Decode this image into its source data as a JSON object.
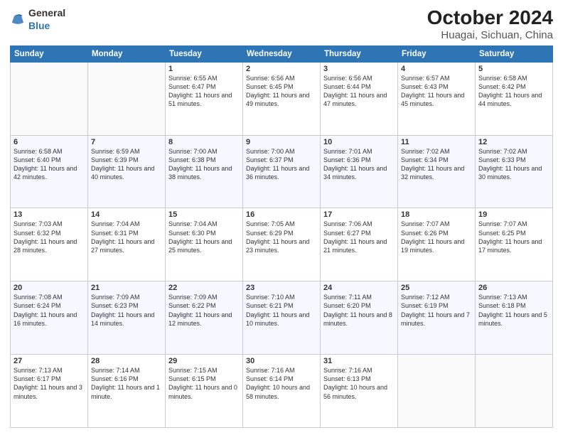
{
  "header": {
    "logo_general": "General",
    "logo_blue": "Blue",
    "title": "October 2024",
    "subtitle": "Huagai, Sichuan, China"
  },
  "weekdays": [
    "Sunday",
    "Monday",
    "Tuesday",
    "Wednesday",
    "Thursday",
    "Friday",
    "Saturday"
  ],
  "weeks": [
    [
      {
        "day": "",
        "sunrise": "",
        "sunset": "",
        "daylight": ""
      },
      {
        "day": "",
        "sunrise": "",
        "sunset": "",
        "daylight": ""
      },
      {
        "day": "1",
        "sunrise": "Sunrise: 6:55 AM",
        "sunset": "Sunset: 6:47 PM",
        "daylight": "Daylight: 11 hours and 51 minutes."
      },
      {
        "day": "2",
        "sunrise": "Sunrise: 6:56 AM",
        "sunset": "Sunset: 6:45 PM",
        "daylight": "Daylight: 11 hours and 49 minutes."
      },
      {
        "day": "3",
        "sunrise": "Sunrise: 6:56 AM",
        "sunset": "Sunset: 6:44 PM",
        "daylight": "Daylight: 11 hours and 47 minutes."
      },
      {
        "day": "4",
        "sunrise": "Sunrise: 6:57 AM",
        "sunset": "Sunset: 6:43 PM",
        "daylight": "Daylight: 11 hours and 45 minutes."
      },
      {
        "day": "5",
        "sunrise": "Sunrise: 6:58 AM",
        "sunset": "Sunset: 6:42 PM",
        "daylight": "Daylight: 11 hours and 44 minutes."
      }
    ],
    [
      {
        "day": "6",
        "sunrise": "Sunrise: 6:58 AM",
        "sunset": "Sunset: 6:40 PM",
        "daylight": "Daylight: 11 hours and 42 minutes."
      },
      {
        "day": "7",
        "sunrise": "Sunrise: 6:59 AM",
        "sunset": "Sunset: 6:39 PM",
        "daylight": "Daylight: 11 hours and 40 minutes."
      },
      {
        "day": "8",
        "sunrise": "Sunrise: 7:00 AM",
        "sunset": "Sunset: 6:38 PM",
        "daylight": "Daylight: 11 hours and 38 minutes."
      },
      {
        "day": "9",
        "sunrise": "Sunrise: 7:00 AM",
        "sunset": "Sunset: 6:37 PM",
        "daylight": "Daylight: 11 hours and 36 minutes."
      },
      {
        "day": "10",
        "sunrise": "Sunrise: 7:01 AM",
        "sunset": "Sunset: 6:36 PM",
        "daylight": "Daylight: 11 hours and 34 minutes."
      },
      {
        "day": "11",
        "sunrise": "Sunrise: 7:02 AM",
        "sunset": "Sunset: 6:34 PM",
        "daylight": "Daylight: 11 hours and 32 minutes."
      },
      {
        "day": "12",
        "sunrise": "Sunrise: 7:02 AM",
        "sunset": "Sunset: 6:33 PM",
        "daylight": "Daylight: 11 hours and 30 minutes."
      }
    ],
    [
      {
        "day": "13",
        "sunrise": "Sunrise: 7:03 AM",
        "sunset": "Sunset: 6:32 PM",
        "daylight": "Daylight: 11 hours and 28 minutes."
      },
      {
        "day": "14",
        "sunrise": "Sunrise: 7:04 AM",
        "sunset": "Sunset: 6:31 PM",
        "daylight": "Daylight: 11 hours and 27 minutes."
      },
      {
        "day": "15",
        "sunrise": "Sunrise: 7:04 AM",
        "sunset": "Sunset: 6:30 PM",
        "daylight": "Daylight: 11 hours and 25 minutes."
      },
      {
        "day": "16",
        "sunrise": "Sunrise: 7:05 AM",
        "sunset": "Sunset: 6:29 PM",
        "daylight": "Daylight: 11 hours and 23 minutes."
      },
      {
        "day": "17",
        "sunrise": "Sunrise: 7:06 AM",
        "sunset": "Sunset: 6:27 PM",
        "daylight": "Daylight: 11 hours and 21 minutes."
      },
      {
        "day": "18",
        "sunrise": "Sunrise: 7:07 AM",
        "sunset": "Sunset: 6:26 PM",
        "daylight": "Daylight: 11 hours and 19 minutes."
      },
      {
        "day": "19",
        "sunrise": "Sunrise: 7:07 AM",
        "sunset": "Sunset: 6:25 PM",
        "daylight": "Daylight: 11 hours and 17 minutes."
      }
    ],
    [
      {
        "day": "20",
        "sunrise": "Sunrise: 7:08 AM",
        "sunset": "Sunset: 6:24 PM",
        "daylight": "Daylight: 11 hours and 16 minutes."
      },
      {
        "day": "21",
        "sunrise": "Sunrise: 7:09 AM",
        "sunset": "Sunset: 6:23 PM",
        "daylight": "Daylight: 11 hours and 14 minutes."
      },
      {
        "day": "22",
        "sunrise": "Sunrise: 7:09 AM",
        "sunset": "Sunset: 6:22 PM",
        "daylight": "Daylight: 11 hours and 12 minutes."
      },
      {
        "day": "23",
        "sunrise": "Sunrise: 7:10 AM",
        "sunset": "Sunset: 6:21 PM",
        "daylight": "Daylight: 11 hours and 10 minutes."
      },
      {
        "day": "24",
        "sunrise": "Sunrise: 7:11 AM",
        "sunset": "Sunset: 6:20 PM",
        "daylight": "Daylight: 11 hours and 8 minutes."
      },
      {
        "day": "25",
        "sunrise": "Sunrise: 7:12 AM",
        "sunset": "Sunset: 6:19 PM",
        "daylight": "Daylight: 11 hours and 7 minutes."
      },
      {
        "day": "26",
        "sunrise": "Sunrise: 7:13 AM",
        "sunset": "Sunset: 6:18 PM",
        "daylight": "Daylight: 11 hours and 5 minutes."
      }
    ],
    [
      {
        "day": "27",
        "sunrise": "Sunrise: 7:13 AM",
        "sunset": "Sunset: 6:17 PM",
        "daylight": "Daylight: 11 hours and 3 minutes."
      },
      {
        "day": "28",
        "sunrise": "Sunrise: 7:14 AM",
        "sunset": "Sunset: 6:16 PM",
        "daylight": "Daylight: 11 hours and 1 minute."
      },
      {
        "day": "29",
        "sunrise": "Sunrise: 7:15 AM",
        "sunset": "Sunset: 6:15 PM",
        "daylight": "Daylight: 11 hours and 0 minutes."
      },
      {
        "day": "30",
        "sunrise": "Sunrise: 7:16 AM",
        "sunset": "Sunset: 6:14 PM",
        "daylight": "Daylight: 10 hours and 58 minutes."
      },
      {
        "day": "31",
        "sunrise": "Sunrise: 7:16 AM",
        "sunset": "Sunset: 6:13 PM",
        "daylight": "Daylight: 10 hours and 56 minutes."
      },
      {
        "day": "",
        "sunrise": "",
        "sunset": "",
        "daylight": ""
      },
      {
        "day": "",
        "sunrise": "",
        "sunset": "",
        "daylight": ""
      }
    ]
  ]
}
